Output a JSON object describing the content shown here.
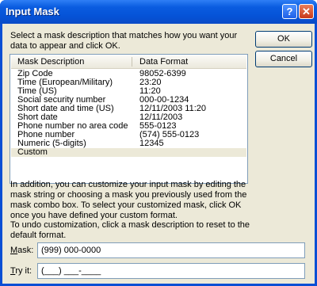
{
  "window": {
    "title": "Input Mask",
    "help_glyph": "?",
    "close_glyph": "✕"
  },
  "instruction": "Select a mask description that matches how you want your data to appear and click OK.",
  "buttons": {
    "ok": "OK",
    "cancel": "Cancel"
  },
  "table": {
    "columns": [
      "Mask Description",
      "Data Format"
    ],
    "rows": [
      [
        "Zip Code",
        "98052-6399"
      ],
      [
        "Time (European/Military)",
        "23:20"
      ],
      [
        "Time (US)",
        "11:20"
      ],
      [
        "Social security number",
        "000-00-1234"
      ],
      [
        "Short date and time (US)",
        "12/11/2003 11:20"
      ],
      [
        "Short date",
        "12/11/2003"
      ],
      [
        "Phone number no area code",
        "555-0123"
      ],
      [
        "Phone number",
        "(574) 555-0123"
      ],
      [
        "Numeric (5-digits)",
        "12345"
      ],
      [
        "Custom",
        ""
      ]
    ],
    "selected_row": 9
  },
  "info_customize": "In addition, you can customize your input mask by editing the mask string or choosing a mask you previously used from the mask combo box. To select your customized mask, click OK once you have defined your custom format.",
  "info_undo": "To undo customization, click a mask description to reset to the default format.",
  "mask": {
    "label_access": "M",
    "label_rest": "ask:",
    "value": "(999) 000-0000"
  },
  "tryit": {
    "label_access": "T",
    "label_rest": "ry it:",
    "value": "(___) ___-____"
  }
}
